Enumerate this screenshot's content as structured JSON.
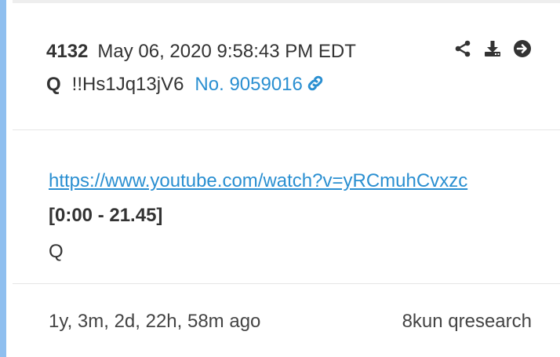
{
  "post": {
    "number": "4132",
    "datetime": "May 06, 2020 9:58:43 PM EDT",
    "author": "Q",
    "tripcode": "!!Hs1Jq13jV6",
    "post_link": "No. 9059016"
  },
  "actions": {
    "icons": [
      "share-icon",
      "download-icon",
      "arrow-right-circle-icon"
    ]
  },
  "content": {
    "url": "https://www.youtube.com/watch?v=yRCmuhCvxzc",
    "time_range": "[0:00 - 21.45]",
    "signature": "Q"
  },
  "footer": {
    "age": "1y, 3m, 2d, 22h, 58m ago",
    "source": "8kun qresearch"
  },
  "colors": {
    "accent": "#2a8fd1",
    "left_border": "#8fbfef",
    "text": "#333333"
  }
}
